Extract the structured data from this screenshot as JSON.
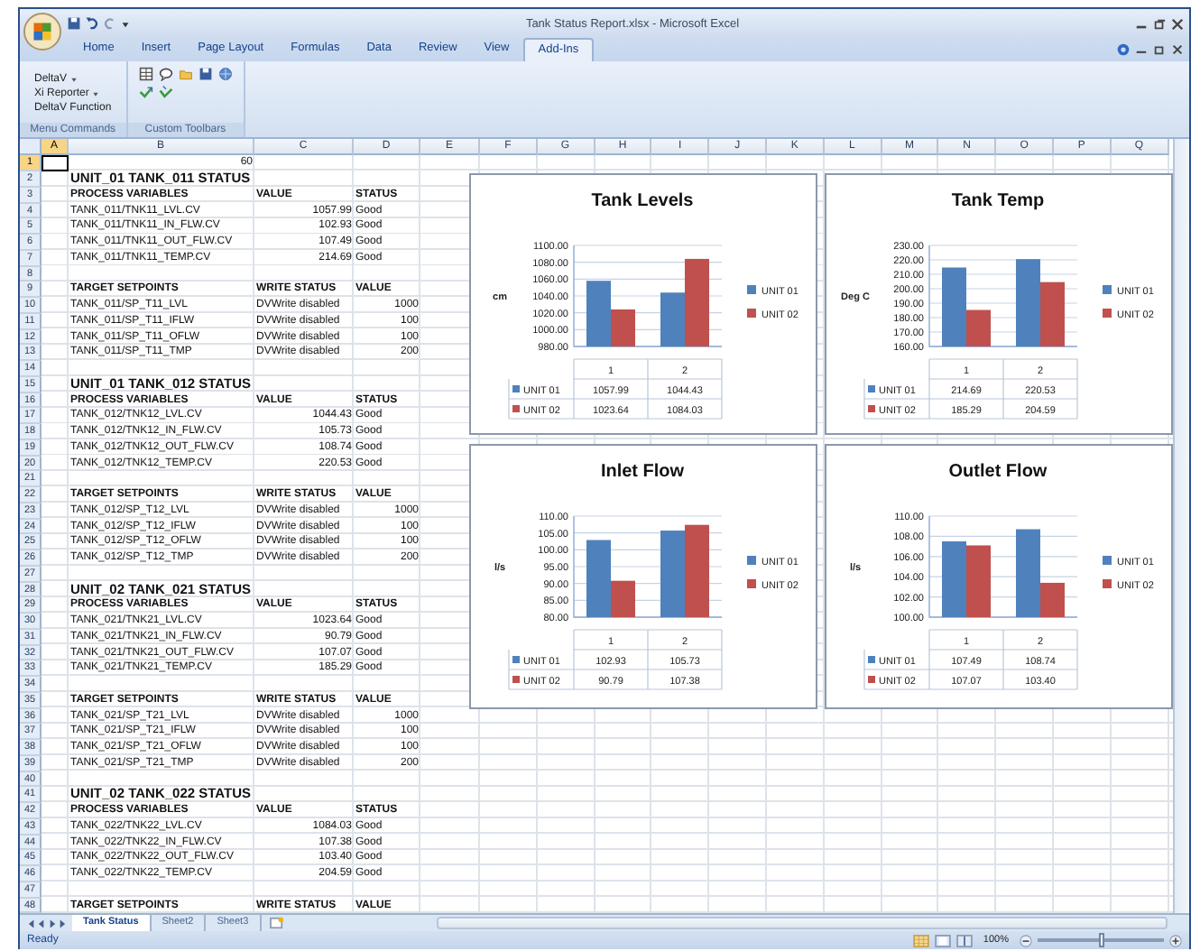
{
  "window": {
    "title": "Tank Status Report.xlsx - Microsoft Excel"
  },
  "ribbon": {
    "tabs": [
      {
        "label": "Home",
        "selected": false
      },
      {
        "label": "Insert",
        "selected": false
      },
      {
        "label": "Page Layout",
        "selected": false
      },
      {
        "label": "Formulas",
        "selected": false
      },
      {
        "label": "Data",
        "selected": false
      },
      {
        "label": "Review",
        "selected": false
      },
      {
        "label": "View",
        "selected": false
      },
      {
        "label": "Add-Ins",
        "selected": true
      }
    ],
    "groups": [
      {
        "label": "Menu Commands",
        "kind": "menu",
        "items": [
          {
            "label": "DeltaV",
            "dropdown": true
          },
          {
            "label": "Xi Reporter",
            "dropdown": true
          },
          {
            "label": "DeltaV Function",
            "dropdown": false
          }
        ]
      },
      {
        "label": "Custom Toolbars",
        "kind": "icons"
      }
    ]
  },
  "sheet": {
    "columns": [
      {
        "label": "A",
        "selected": true
      },
      {
        "label": "B",
        "selected": false
      },
      {
        "label": "C",
        "selected": false
      },
      {
        "label": "D",
        "selected": false
      },
      {
        "label": "E",
        "selected": false
      },
      {
        "label": "F",
        "selected": false
      },
      {
        "label": "G",
        "selected": false
      },
      {
        "label": "H",
        "selected": false
      },
      {
        "label": "I",
        "selected": false
      },
      {
        "label": "J",
        "selected": false
      },
      {
        "label": "K",
        "selected": false
      },
      {
        "label": "L",
        "selected": false
      },
      {
        "label": "M",
        "selected": false
      },
      {
        "label": "N",
        "selected": false
      },
      {
        "label": "O",
        "selected": false
      },
      {
        "label": "P",
        "selected": false
      },
      {
        "label": "Q",
        "selected": false
      }
    ],
    "rows": [
      {
        "n": "1",
        "kind": "count",
        "selected": true,
        "cells": [
          "",
          "60"
        ]
      },
      {
        "n": "2",
        "kind": "title",
        "selected": false,
        "cells": [
          "",
          "UNIT_01 TANK_011 STATUS"
        ]
      },
      {
        "n": "3",
        "kind": "header",
        "selected": false,
        "cells": [
          "",
          "PROCESS VARIABLES",
          "VALUE",
          "STATUS"
        ]
      },
      {
        "n": "4",
        "kind": "pv",
        "selected": false,
        "cells": [
          "",
          "TANK_011/TNK11_LVL.CV",
          "1057.99",
          "Good"
        ]
      },
      {
        "n": "5",
        "kind": "pv",
        "selected": false,
        "cells": [
          "",
          "TANK_011/TNK11_IN_FLW.CV",
          "102.93",
          "Good"
        ]
      },
      {
        "n": "6",
        "kind": "pv",
        "selected": false,
        "cells": [
          "",
          "TANK_011/TNK11_OUT_FLW.CV",
          "107.49",
          "Good"
        ]
      },
      {
        "n": "7",
        "kind": "pv",
        "selected": false,
        "cells": [
          "",
          "TANK_011/TNK11_TEMP.CV",
          "214.69",
          "Good"
        ]
      },
      {
        "n": "8",
        "kind": "blank",
        "selected": false,
        "cells": []
      },
      {
        "n": "9",
        "kind": "header",
        "selected": false,
        "cells": [
          "",
          "TARGET SETPOINTS",
          "WRITE STATUS",
          "VALUE"
        ]
      },
      {
        "n": "10",
        "kind": "sp",
        "selected": false,
        "cells": [
          "",
          "TANK_011/SP_T11_LVL",
          "DVWrite disabled",
          "1000"
        ]
      },
      {
        "n": "11",
        "kind": "sp",
        "selected": false,
        "cells": [
          "",
          "TANK_011/SP_T11_IFLW",
          "DVWrite disabled",
          "100"
        ]
      },
      {
        "n": "12",
        "kind": "sp",
        "selected": false,
        "cells": [
          "",
          "TANK_011/SP_T11_OFLW",
          "DVWrite disabled",
          "100"
        ]
      },
      {
        "n": "13",
        "kind": "sp",
        "selected": false,
        "cells": [
          "",
          "TANK_011/SP_T11_TMP",
          "DVWrite disabled",
          "200"
        ]
      },
      {
        "n": "14",
        "kind": "blank",
        "selected": false,
        "cells": []
      },
      {
        "n": "15",
        "kind": "title",
        "selected": false,
        "cells": [
          "",
          "UNIT_01 TANK_012 STATUS"
        ]
      },
      {
        "n": "16",
        "kind": "header",
        "selected": false,
        "cells": [
          "",
          "PROCESS VARIABLES",
          "VALUE",
          "STATUS"
        ]
      },
      {
        "n": "17",
        "kind": "pv",
        "selected": false,
        "cells": [
          "",
          "TANK_012/TNK12_LVL.CV",
          "1044.43",
          "Good"
        ]
      },
      {
        "n": "18",
        "kind": "pv",
        "selected": false,
        "cells": [
          "",
          "TANK_012/TNK12_IN_FLW.CV",
          "105.73",
          "Good"
        ]
      },
      {
        "n": "19",
        "kind": "pv",
        "selected": false,
        "cells": [
          "",
          "TANK_012/TNK12_OUT_FLW.CV",
          "108.74",
          "Good"
        ]
      },
      {
        "n": "20",
        "kind": "pv",
        "selected": false,
        "cells": [
          "",
          "TANK_012/TNK12_TEMP.CV",
          "220.53",
          "Good"
        ]
      },
      {
        "n": "21",
        "kind": "blank",
        "selected": false,
        "cells": []
      },
      {
        "n": "22",
        "kind": "header",
        "selected": false,
        "cells": [
          "",
          "TARGET SETPOINTS",
          "WRITE STATUS",
          "VALUE"
        ]
      },
      {
        "n": "23",
        "kind": "sp",
        "selected": false,
        "cells": [
          "",
          "TANK_012/SP_T12_LVL",
          "DVWrite disabled",
          "1000"
        ]
      },
      {
        "n": "24",
        "kind": "sp",
        "selected": false,
        "cells": [
          "",
          "TANK_012/SP_T12_IFLW",
          "DVWrite disabled",
          "100"
        ]
      },
      {
        "n": "25",
        "kind": "sp",
        "selected": false,
        "cells": [
          "",
          "TANK_012/SP_T12_OFLW",
          "DVWrite disabled",
          "100"
        ]
      },
      {
        "n": "26",
        "kind": "sp",
        "selected": false,
        "cells": [
          "",
          "TANK_012/SP_T12_TMP",
          "DVWrite disabled",
          "200"
        ]
      },
      {
        "n": "27",
        "kind": "blank",
        "selected": false,
        "cells": []
      },
      {
        "n": "28",
        "kind": "title",
        "selected": false,
        "cells": [
          "",
          "UNIT_02 TANK_021 STATUS"
        ]
      },
      {
        "n": "29",
        "kind": "header",
        "selected": false,
        "cells": [
          "",
          "PROCESS VARIABLES",
          "VALUE",
          "STATUS"
        ]
      },
      {
        "n": "30",
        "kind": "pv",
        "selected": false,
        "cells": [
          "",
          "TANK_021/TNK21_LVL.CV",
          "1023.64",
          "Good"
        ]
      },
      {
        "n": "31",
        "kind": "pv",
        "selected": false,
        "cells": [
          "",
          "TANK_021/TNK21_IN_FLW.CV",
          "90.79",
          "Good"
        ]
      },
      {
        "n": "32",
        "kind": "pv",
        "selected": false,
        "cells": [
          "",
          "TANK_021/TNK21_OUT_FLW.CV",
          "107.07",
          "Good"
        ]
      },
      {
        "n": "33",
        "kind": "pv",
        "selected": false,
        "cells": [
          "",
          "TANK_021/TNK21_TEMP.CV",
          "185.29",
          "Good"
        ]
      },
      {
        "n": "34",
        "kind": "blank",
        "selected": false,
        "cells": []
      },
      {
        "n": "35",
        "kind": "header",
        "selected": false,
        "cells": [
          "",
          "TARGET SETPOINTS",
          "WRITE STATUS",
          "VALUE"
        ]
      },
      {
        "n": "36",
        "kind": "sp",
        "selected": false,
        "cells": [
          "",
          "TANK_021/SP_T21_LVL",
          "DVWrite disabled",
          "1000"
        ]
      },
      {
        "n": "37",
        "kind": "sp",
        "selected": false,
        "cells": [
          "",
          "TANK_021/SP_T21_IFLW",
          "DVWrite disabled",
          "100"
        ]
      },
      {
        "n": "38",
        "kind": "sp",
        "selected": false,
        "cells": [
          "",
          "TANK_021/SP_T21_OFLW",
          "DVWrite disabled",
          "100"
        ]
      },
      {
        "n": "39",
        "kind": "sp",
        "selected": false,
        "cells": [
          "",
          "TANK_021/SP_T21_TMP",
          "DVWrite disabled",
          "200"
        ]
      },
      {
        "n": "40",
        "kind": "blank",
        "selected": false,
        "cells": []
      },
      {
        "n": "41",
        "kind": "title",
        "selected": false,
        "cells": [
          "",
          "UNIT_02 TANK_022 STATUS"
        ]
      },
      {
        "n": "42",
        "kind": "header",
        "selected": false,
        "cells": [
          "",
          "PROCESS VARIABLES",
          "VALUE",
          "STATUS"
        ]
      },
      {
        "n": "43",
        "kind": "pv",
        "selected": false,
        "cells": [
          "",
          "TANK_022/TNK22_LVL.CV",
          "1084.03",
          "Good"
        ]
      },
      {
        "n": "44",
        "kind": "pv",
        "selected": false,
        "cells": [
          "",
          "TANK_022/TNK22_IN_FLW.CV",
          "107.38",
          "Good"
        ]
      },
      {
        "n": "45",
        "kind": "pv",
        "selected": false,
        "cells": [
          "",
          "TANK_022/TNK22_OUT_FLW.CV",
          "103.40",
          "Good"
        ]
      },
      {
        "n": "46",
        "kind": "pv",
        "selected": false,
        "cells": [
          "",
          "TANK_022/TNK22_TEMP.CV",
          "204.59",
          "Good"
        ]
      },
      {
        "n": "47",
        "kind": "blank",
        "selected": false,
        "cells": []
      },
      {
        "n": "48",
        "kind": "header",
        "selected": false,
        "cells": [
          "",
          "TARGET SETPOINTS",
          "WRITE STATUS",
          "VALUE"
        ]
      }
    ]
  },
  "charts": [
    {
      "chart_data": {
        "type": "bar",
        "title": "Tank Levels",
        "grid": true,
        "legend": "right",
        "ylabel": "cm",
        "categories": [
          "1",
          "2"
        ],
        "ylim": [
          980,
          1100
        ],
        "yticks": [
          {
            "value": 980,
            "label": "980.00"
          },
          {
            "value": 1000,
            "label": "1000.00"
          },
          {
            "value": 1020,
            "label": "1020.00"
          },
          {
            "value": 1040,
            "label": "1040.00"
          },
          {
            "value": 1060,
            "label": "1060.00"
          },
          {
            "value": 1080,
            "label": "1080.00"
          },
          {
            "value": 1100,
            "label": "1100.00"
          }
        ],
        "series": [
          {
            "name": "UNIT 01",
            "color": "#4f81bd",
            "values": [
              1058,
              1044
            ]
          },
          {
            "name": "UNIT 02",
            "color": "#c0504d",
            "values": [
              1024,
              1084
            ]
          }
        ]
      },
      "data_table": [
        {
          "label": "UNIT 01",
          "cells": [
            "1057.99",
            "1044.43"
          ]
        },
        {
          "label": "UNIT 02",
          "cells": [
            "1023.64",
            "1084.03"
          ]
        }
      ]
    },
    {
      "chart_data": {
        "type": "bar",
        "title": "Tank Temp",
        "grid": true,
        "legend": "right",
        "ylabel": "Deg C",
        "categories": [
          "1",
          "2"
        ],
        "ylim": [
          160,
          230
        ],
        "yticks": [
          {
            "value": 160,
            "label": "160.00"
          },
          {
            "value": 170,
            "label": "170.00"
          },
          {
            "value": 180,
            "label": "180.00"
          },
          {
            "value": 190,
            "label": "190.00"
          },
          {
            "value": 200,
            "label": "200.00"
          },
          {
            "value": 210,
            "label": "210.00"
          },
          {
            "value": 220,
            "label": "220.00"
          },
          {
            "value": 230,
            "label": "230.00"
          }
        ],
        "series": [
          {
            "name": "UNIT 01",
            "color": "#4f81bd",
            "values": [
              214.7,
              220.5
            ]
          },
          {
            "name": "UNIT 02",
            "color": "#c0504d",
            "values": [
              185.3,
              204.6
            ]
          }
        ]
      },
      "data_table": [
        {
          "label": "UNIT 01",
          "cells": [
            "214.69",
            "220.53"
          ]
        },
        {
          "label": "UNIT 02",
          "cells": [
            "185.29",
            "204.59"
          ]
        }
      ]
    },
    {
      "chart_data": {
        "type": "bar",
        "title": "Inlet Flow",
        "grid": true,
        "legend": "right",
        "ylabel": "l/s",
        "categories": [
          "1",
          "2"
        ],
        "ylim": [
          80,
          110
        ],
        "yticks": [
          {
            "value": 80,
            "label": "80.00"
          },
          {
            "value": 85,
            "label": "85.00"
          },
          {
            "value": 90,
            "label": "90.00"
          },
          {
            "value": 95,
            "label": "95.00"
          },
          {
            "value": 100,
            "label": "100.00"
          },
          {
            "value": 105,
            "label": "105.00"
          },
          {
            "value": 110,
            "label": "110.00"
          }
        ],
        "series": [
          {
            "name": "UNIT 01",
            "color": "#4f81bd",
            "values": [
              102.9,
              105.7
            ]
          },
          {
            "name": "UNIT 02",
            "color": "#c0504d",
            "values": [
              90.8,
              107.4
            ]
          }
        ]
      },
      "data_table": [
        {
          "label": "UNIT 01",
          "cells": [
            "102.93",
            "105.73"
          ]
        },
        {
          "label": "UNIT 02",
          "cells": [
            "90.79",
            "107.38"
          ]
        }
      ]
    },
    {
      "chart_data": {
        "type": "bar",
        "title": "Outlet Flow",
        "grid": true,
        "legend": "right",
        "ylabel": "l/s",
        "categories": [
          "1",
          "2"
        ],
        "ylim": [
          100,
          110
        ],
        "yticks": [
          {
            "value": 100,
            "label": "100.00"
          },
          {
            "value": 102,
            "label": "102.00"
          },
          {
            "value": 104,
            "label": "104.00"
          },
          {
            "value": 106,
            "label": "106.00"
          },
          {
            "value": 108,
            "label": "108.00"
          },
          {
            "value": 110,
            "label": "110.00"
          }
        ],
        "series": [
          {
            "name": "UNIT 01",
            "color": "#4f81bd",
            "values": [
              107.5,
              108.7
            ]
          },
          {
            "name": "UNIT 02",
            "color": "#c0504d",
            "values": [
              107.1,
              103.4
            ]
          }
        ]
      },
      "data_table": [
        {
          "label": "UNIT 01",
          "cells": [
            "107.49",
            "108.74"
          ]
        },
        {
          "label": "UNIT 02",
          "cells": [
            "107.07",
            "103.40"
          ]
        }
      ]
    }
  ],
  "sheet_tabs": [
    {
      "label": "Tank Status",
      "selected": true
    },
    {
      "label": "Sheet2",
      "selected": false
    },
    {
      "label": "Sheet3",
      "selected": false
    }
  ],
  "status_bar": {
    "text": "Ready",
    "zoom": "100%",
    "zoom_slider": {
      "level": 0.5
    }
  }
}
